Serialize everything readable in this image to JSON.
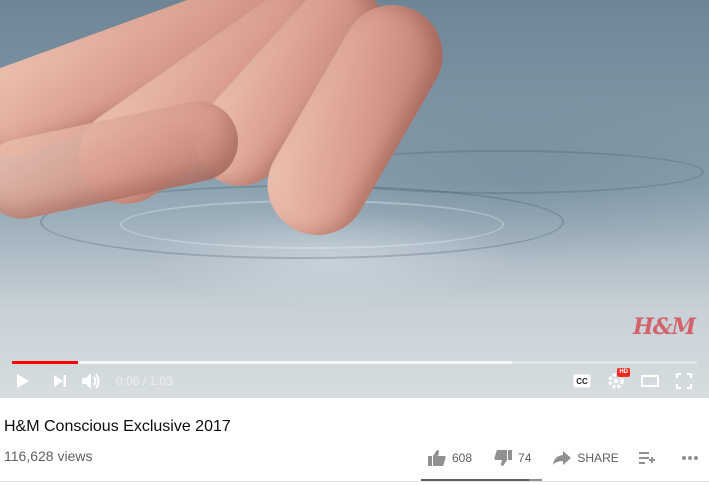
{
  "video": {
    "watermark": "H&M",
    "progress": {
      "played_fraction": 0.097,
      "loaded_fraction": 0.73
    },
    "controls": {
      "time_current": "0:06",
      "time_total": "1:03",
      "time_display": "0:06 / 1:03",
      "hd_badge": "HD"
    },
    "colors": {
      "progress_played": "#ff0000",
      "watermark": "#d63c46"
    }
  },
  "meta": {
    "title": "H&M Conscious Exclusive 2017",
    "views": "116,628 views",
    "likes": "608",
    "dislikes": "74",
    "share_label": "SHARE"
  },
  "icons": [
    "play-icon",
    "next-icon",
    "volume-icon",
    "captions-icon",
    "settings-icon",
    "theater-icon",
    "fullscreen-icon",
    "thumb-up-icon",
    "thumb-down-icon",
    "share-icon",
    "add-to-playlist-icon",
    "more-icon"
  ]
}
